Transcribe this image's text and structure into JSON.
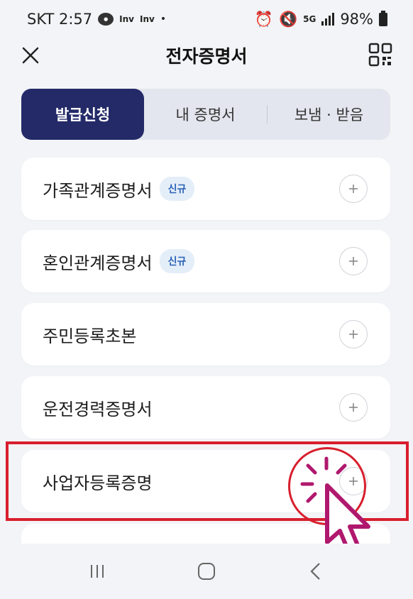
{
  "status_bar": {
    "carrier_time": "SKT 2:57",
    "indicator_1": "Inv",
    "indicator_2": "Inv",
    "battery": "98%"
  },
  "header": {
    "title": "전자증명서"
  },
  "tabs": [
    {
      "label": "발급신청",
      "active": true
    },
    {
      "label": "내 증명서",
      "active": false
    },
    {
      "label": "보냄 · 받음",
      "active": false
    }
  ],
  "certificates": [
    {
      "label": "가족관계증명서",
      "badge": "신규"
    },
    {
      "label": "혼인관계증명서",
      "badge": "신규"
    },
    {
      "label": "주민등록초본",
      "badge": ""
    },
    {
      "label": "운전경력증명서",
      "badge": ""
    },
    {
      "label": "사업자등록증명",
      "badge": ""
    }
  ],
  "colors": {
    "accent": "#242a68",
    "badge_text": "#2b63b6",
    "badge_bg": "#e4eef9",
    "highlight": "#d81f2e",
    "cursor": "#b0186e"
  }
}
